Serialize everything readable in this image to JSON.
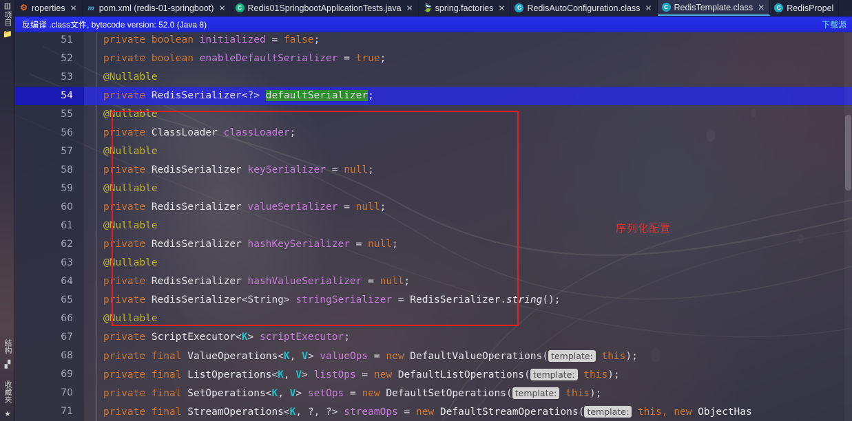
{
  "window": {
    "app": "IntelliJ IDEA",
    "theme_accent": "#4bb5d6"
  },
  "tool_strip": {
    "items": [
      {
        "name": "project-tool-window",
        "label": "项目",
        "icon": "grid-icon"
      },
      {
        "name": "folder-tool-window",
        "label": "",
        "icon": "folder-icon"
      },
      {
        "name": "structure-tool-window",
        "label": "结构",
        "icon": "structure-icon"
      },
      {
        "name": "favorites-tool-window",
        "label": "收藏夹",
        "icon": "star-icon"
      }
    ]
  },
  "tabs": [
    {
      "label": "roperties",
      "icon": "properties-icon",
      "icon_glyph": "⚙",
      "active": false,
      "close": "✕"
    },
    {
      "label": "pom.xml (redis-01-springboot)",
      "icon": "maven-icon",
      "icon_glyph": "m",
      "active": false,
      "close": "✕"
    },
    {
      "label": "Redis01SpringbootApplicationTests.java",
      "icon": "test-class-icon",
      "icon_glyph": "C",
      "active": false,
      "close": "✕"
    },
    {
      "label": "spring.factories",
      "icon": "factories-icon",
      "icon_glyph": "🍃",
      "active": false,
      "close": "✕"
    },
    {
      "label": "RedisAutoConfiguration.class",
      "icon": "class-file-icon",
      "icon_glyph": "C",
      "active": false,
      "close": "✕"
    },
    {
      "label": "RedisTemplate.class",
      "icon": "class-file-icon",
      "icon_glyph": "C",
      "active": true,
      "close": "✕"
    },
    {
      "label": "RedisPropel",
      "icon": "class-file-icon",
      "icon_glyph": "C",
      "active": false,
      "close": ""
    }
  ],
  "banner": {
    "text": "反编译 .class文件, bytecode version: 52.0 (Java 8)",
    "link": "下载源",
    "background": "#2128d8"
  },
  "annotation": {
    "label": "序列化配置",
    "color": "#e03232"
  },
  "editor": {
    "current_line": 54,
    "lines": [
      {
        "num": 51,
        "tokens": [
          {
            "t": "private ",
            "c": "kw"
          },
          {
            "t": "boolean ",
            "c": "kw"
          },
          {
            "t": "initialized",
            "c": "fld"
          },
          {
            "t": " = ",
            "c": "punc"
          },
          {
            "t": "false",
            "c": "num"
          },
          {
            "t": ";",
            "c": "punc"
          }
        ]
      },
      {
        "num": 52,
        "tokens": [
          {
            "t": "private ",
            "c": "kw"
          },
          {
            "t": "boolean ",
            "c": "kw"
          },
          {
            "t": "enableDefaultSerializer",
            "c": "fld"
          },
          {
            "t": " = ",
            "c": "punc"
          },
          {
            "t": "true",
            "c": "num"
          },
          {
            "t": ";",
            "c": "punc"
          }
        ]
      },
      {
        "num": 53,
        "tokens": [
          {
            "t": "@Nullable",
            "c": "anno"
          }
        ]
      },
      {
        "num": 54,
        "tokens": [
          {
            "t": "private ",
            "c": "kw"
          },
          {
            "t": "RedisSerializer",
            "c": "type"
          },
          {
            "t": "<?> ",
            "c": "punc"
          },
          {
            "t": "defaultSerializer",
            "c": "sel-green"
          },
          {
            "t": ";",
            "c": "punc"
          }
        ]
      },
      {
        "num": 55,
        "tokens": [
          {
            "t": "@Nullable",
            "c": "anno"
          }
        ]
      },
      {
        "num": 56,
        "tokens": [
          {
            "t": "private ",
            "c": "kw"
          },
          {
            "t": "ClassLoader ",
            "c": "type"
          },
          {
            "t": "classLoader",
            "c": "fld"
          },
          {
            "t": ";",
            "c": "punc"
          }
        ]
      },
      {
        "num": 57,
        "tokens": [
          {
            "t": "@Nullable",
            "c": "anno"
          }
        ]
      },
      {
        "num": 58,
        "tokens": [
          {
            "t": "private ",
            "c": "kw"
          },
          {
            "t": "RedisSerializer ",
            "c": "type"
          },
          {
            "t": "keySerializer",
            "c": "fld"
          },
          {
            "t": " = ",
            "c": "punc"
          },
          {
            "t": "null",
            "c": "kw"
          },
          {
            "t": ";",
            "c": "punc"
          }
        ]
      },
      {
        "num": 59,
        "tokens": [
          {
            "t": "@Nullable",
            "c": "anno"
          }
        ]
      },
      {
        "num": 60,
        "tokens": [
          {
            "t": "private ",
            "c": "kw"
          },
          {
            "t": "RedisSerializer ",
            "c": "type"
          },
          {
            "t": "valueSerializer",
            "c": "fld"
          },
          {
            "t": " = ",
            "c": "punc"
          },
          {
            "t": "null",
            "c": "kw"
          },
          {
            "t": ";",
            "c": "punc"
          }
        ]
      },
      {
        "num": 61,
        "tokens": [
          {
            "t": "@Nullable",
            "c": "anno"
          }
        ]
      },
      {
        "num": 62,
        "tokens": [
          {
            "t": "private ",
            "c": "kw"
          },
          {
            "t": "RedisSerializer ",
            "c": "type"
          },
          {
            "t": "hashKeySerializer",
            "c": "fld"
          },
          {
            "t": " = ",
            "c": "punc"
          },
          {
            "t": "null",
            "c": "kw"
          },
          {
            "t": ";",
            "c": "punc"
          }
        ]
      },
      {
        "num": 63,
        "tokens": [
          {
            "t": "@Nullable",
            "c": "anno"
          }
        ]
      },
      {
        "num": 64,
        "tokens": [
          {
            "t": "private ",
            "c": "kw"
          },
          {
            "t": "RedisSerializer ",
            "c": "type"
          },
          {
            "t": "hashValueSerializer",
            "c": "fld"
          },
          {
            "t": " = ",
            "c": "punc"
          },
          {
            "t": "null",
            "c": "kw"
          },
          {
            "t": ";",
            "c": "punc"
          }
        ]
      },
      {
        "num": 65,
        "tokens": [
          {
            "t": "private ",
            "c": "kw"
          },
          {
            "t": "RedisSerializer",
            "c": "type"
          },
          {
            "t": "<String> ",
            "c": "punc"
          },
          {
            "t": "stringSerializer",
            "c": "fld"
          },
          {
            "t": " = ",
            "c": "punc"
          },
          {
            "t": "RedisSerializer",
            "c": "type"
          },
          {
            "t": ".",
            "c": "punc"
          },
          {
            "t": "string",
            "c": "meth"
          },
          {
            "t": "();",
            "c": "punc"
          }
        ]
      },
      {
        "num": 66,
        "tokens": [
          {
            "t": "@Nullable",
            "c": "anno"
          }
        ]
      },
      {
        "num": 67,
        "tokens": [
          {
            "t": "private ",
            "c": "kw"
          },
          {
            "t": "ScriptExecutor",
            "c": "type"
          },
          {
            "t": "<",
            "c": "punc"
          },
          {
            "t": "K",
            "c": "gen"
          },
          {
            "t": "> ",
            "c": "punc"
          },
          {
            "t": "scriptExecutor",
            "c": "fld"
          },
          {
            "t": ";",
            "c": "punc"
          }
        ]
      },
      {
        "num": 68,
        "tokens": [
          {
            "t": "private ",
            "c": "kw"
          },
          {
            "t": "final ",
            "c": "kw"
          },
          {
            "t": "ValueOperations",
            "c": "type"
          },
          {
            "t": "<",
            "c": "punc"
          },
          {
            "t": "K",
            "c": "gen"
          },
          {
            "t": ", ",
            "c": "punc"
          },
          {
            "t": "V",
            "c": "gen"
          },
          {
            "t": "> ",
            "c": "punc"
          },
          {
            "t": "valueOps",
            "c": "fld"
          },
          {
            "t": " = ",
            "c": "punc"
          },
          {
            "t": "new ",
            "c": "kw"
          },
          {
            "t": "DefaultValueOperations",
            "c": "type"
          },
          {
            "t": "(",
            "c": "punc"
          },
          {
            "t": "template:",
            "c": "hint"
          },
          {
            "t": " ",
            "c": "punc"
          },
          {
            "t": "this",
            "c": "kw"
          },
          {
            "t": ");",
            "c": "punc"
          }
        ]
      },
      {
        "num": 69,
        "tokens": [
          {
            "t": "private ",
            "c": "kw"
          },
          {
            "t": "final ",
            "c": "kw"
          },
          {
            "t": "ListOperations",
            "c": "type"
          },
          {
            "t": "<",
            "c": "punc"
          },
          {
            "t": "K",
            "c": "gen"
          },
          {
            "t": ", ",
            "c": "punc"
          },
          {
            "t": "V",
            "c": "gen"
          },
          {
            "t": "> ",
            "c": "punc"
          },
          {
            "t": "listOps",
            "c": "fld"
          },
          {
            "t": " = ",
            "c": "punc"
          },
          {
            "t": "new ",
            "c": "kw"
          },
          {
            "t": "DefaultListOperations",
            "c": "type"
          },
          {
            "t": "(",
            "c": "punc"
          },
          {
            "t": "template:",
            "c": "hint"
          },
          {
            "t": " ",
            "c": "punc"
          },
          {
            "t": "this",
            "c": "kw"
          },
          {
            "t": ");",
            "c": "punc"
          }
        ]
      },
      {
        "num": 70,
        "tokens": [
          {
            "t": "private ",
            "c": "kw"
          },
          {
            "t": "final ",
            "c": "kw"
          },
          {
            "t": "SetOperations",
            "c": "type"
          },
          {
            "t": "<",
            "c": "punc"
          },
          {
            "t": "K",
            "c": "gen"
          },
          {
            "t": ", ",
            "c": "punc"
          },
          {
            "t": "V",
            "c": "gen"
          },
          {
            "t": "> ",
            "c": "punc"
          },
          {
            "t": "setOps",
            "c": "fld"
          },
          {
            "t": " = ",
            "c": "punc"
          },
          {
            "t": "new ",
            "c": "kw"
          },
          {
            "t": "DefaultSetOperations",
            "c": "type"
          },
          {
            "t": "(",
            "c": "punc"
          },
          {
            "t": "template:",
            "c": "hint"
          },
          {
            "t": " ",
            "c": "punc"
          },
          {
            "t": "this",
            "c": "kw"
          },
          {
            "t": ");",
            "c": "punc"
          }
        ]
      },
      {
        "num": 71,
        "tokens": [
          {
            "t": "private ",
            "c": "kw"
          },
          {
            "t": "final ",
            "c": "kw"
          },
          {
            "t": "StreamOperations",
            "c": "type"
          },
          {
            "t": "<",
            "c": "punc"
          },
          {
            "t": "K",
            "c": "gen"
          },
          {
            "t": ", ?, ?> ",
            "c": "punc"
          },
          {
            "t": "streamOps",
            "c": "fld"
          },
          {
            "t": " = ",
            "c": "punc"
          },
          {
            "t": "new ",
            "c": "kw"
          },
          {
            "t": "DefaultStreamOperations",
            "c": "type"
          },
          {
            "t": "(",
            "c": "punc"
          },
          {
            "t": "template:",
            "c": "hint"
          },
          {
            "t": " ",
            "c": "punc"
          },
          {
            "t": "this, ",
            "c": "kw"
          },
          {
            "t": "new ",
            "c": "kw"
          },
          {
            "t": "ObjectHas",
            "c": "type"
          }
        ]
      }
    ]
  }
}
